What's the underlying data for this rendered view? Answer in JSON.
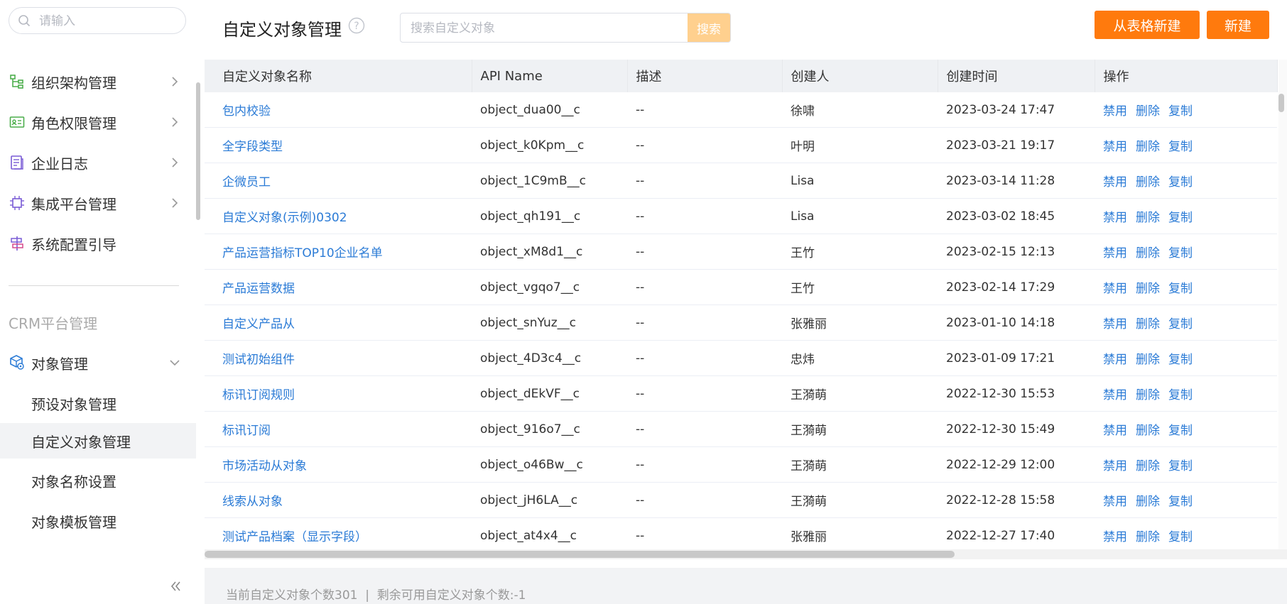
{
  "sidebar": {
    "search_placeholder": "请输入",
    "menu": [
      {
        "label": "组织架构管理"
      },
      {
        "label": "角色权限管理"
      },
      {
        "label": "企业日志"
      },
      {
        "label": "集成平台管理"
      },
      {
        "label": "系统配置引导"
      }
    ],
    "crm_title": "CRM平台管理",
    "object_mgmt": "对象管理",
    "sub_items": [
      {
        "label": "预设对象管理"
      },
      {
        "label": "自定义对象管理"
      },
      {
        "label": "对象名称设置"
      },
      {
        "label": "对象模板管理"
      }
    ]
  },
  "header": {
    "title": "自定义对象管理",
    "search_placeholder": "搜索自定义对象",
    "search_button": "搜索",
    "from_table_button": "从表格新建",
    "new_button": "新建"
  },
  "table": {
    "columns": [
      "自定义对象名称",
      "API Name",
      "描述",
      "创建人",
      "创建时间",
      "操作"
    ],
    "actions": [
      "禁用",
      "删除",
      "复制"
    ],
    "rows": [
      {
        "name": "包内校验",
        "api": "object_dua00__c",
        "desc": "--",
        "creator": "徐啸",
        "time": "2023-03-24 17:47"
      },
      {
        "name": "全字段类型",
        "api": "object_k0Kpm__c",
        "desc": "--",
        "creator": "叶明",
        "time": "2023-03-21 19:17"
      },
      {
        "name": "企微员工",
        "api": "object_1C9mB__c",
        "desc": "--",
        "creator": "Lisa",
        "time": "2023-03-14 11:28"
      },
      {
        "name": "自定义对象(示例)0302",
        "api": "object_qh191__c",
        "desc": "--",
        "creator": "Lisa",
        "time": "2023-03-02 18:45"
      },
      {
        "name": "产品运营指标TOP10企业名单",
        "api": "object_xM8d1__c",
        "desc": "--",
        "creator": "王竹",
        "time": "2023-02-15 12:13"
      },
      {
        "name": "产品运营数据",
        "api": "object_vgqo7__c",
        "desc": "--",
        "creator": "王竹",
        "time": "2023-02-14 17:29"
      },
      {
        "name": "自定义产品从",
        "api": "object_snYuz__c",
        "desc": "--",
        "creator": "张雅丽",
        "time": "2023-01-10 14:18"
      },
      {
        "name": "测试初始组件",
        "api": "object_4D3c4__c",
        "desc": "--",
        "creator": "忠炜",
        "time": "2023-01-09 17:21"
      },
      {
        "name": "标讯订阅规则",
        "api": "object_dEkVF__c",
        "desc": "--",
        "creator": "王漪萌",
        "time": "2022-12-30 15:53"
      },
      {
        "name": "标讯订阅",
        "api": "object_916o7__c",
        "desc": "--",
        "creator": "王漪萌",
        "time": "2022-12-30 15:49"
      },
      {
        "name": "市场活动从对象",
        "api": "object_o46Bw__c",
        "desc": "--",
        "creator": "王漪萌",
        "time": "2022-12-29 12:00"
      },
      {
        "name": "线索从对象",
        "api": "object_jH6LA__c",
        "desc": "--",
        "creator": "王漪萌",
        "time": "2022-12-28 15:58"
      },
      {
        "name": "测试产品档案（显示字段）",
        "api": "object_at4x4__c",
        "desc": "--",
        "creator": "张雅丽",
        "time": "2022-12-27 17:40"
      }
    ]
  },
  "footer": {
    "text": "当前自定义对象个数301  |  剩余可用自定义对象个数:-1"
  },
  "colors": {
    "accent": "#ff7a0d",
    "link": "#2b7bd6",
    "search_button": "#ffd08e"
  }
}
